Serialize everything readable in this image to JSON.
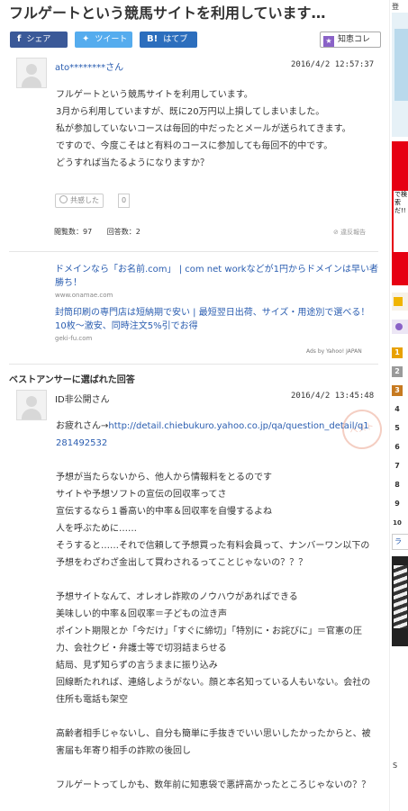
{
  "question": {
    "title": "フルゲートという競馬サイトを利用しています…",
    "share": {
      "facebook": "シェア",
      "twitter": "ツイート",
      "hatena": "はてブ"
    },
    "chie_kore": "知恵コレ",
    "username": "ato********さん",
    "date": "2016/4/2 12:57:37",
    "body": [
      "フルゲートという競馬サイトを利用しています。",
      "3月から利用していますが、既に20万円以上損してしまいました。",
      "私が参加していないコースは毎回的中だったとメールが送られてきます。",
      "ですので、今度こそはと有料のコースに参加しても毎回不的中です。",
      "どうすれば当たるようになりますか？"
    ],
    "empathy_label": "共感した",
    "empathy_count": "0",
    "views": "閲覧数：97",
    "answers": "回答数：2",
    "report": "違反報告"
  },
  "ads": [
    {
      "title": "ドメインなら「お名前.com」 | com net workなどが1円からドメインは早い者勝ち！",
      "domain": "www.onamae.com"
    },
    {
      "title": "封筒印刷の専門店は短納期で安い | 最短翌日出荷、サイズ・用途別で選べる！10枚〜激安、同時注文5%引でお得",
      "domain": "geki-fu.com"
    }
  ],
  "ads_by": "Ads by Yahoo! JAPAN",
  "best_answer": {
    "label": "ベストアンサーに選ばれた回答",
    "username": "ID非公開さん",
    "date": "2016/4/2 13:45:48",
    "intro": "お疲れさん→",
    "link": "http://detail.chiebukuro.yahoo.co.jp/qa/question_detail/q1281492532",
    "p1": [
      "予想が当たらないから、他人から情報料をとるのです",
      "サイトや予想ソフトの宣伝の回収率ってさ",
      "宣伝するなら１番高い的中率＆回収率を自慢するよね",
      "人を呼ぶために……",
      "そうすると……それで信頼して予想買った有料会員って、ナンバーワン以下の予想をわざわざ金出して買わされるってことじゃないの？？？"
    ],
    "p2": [
      "予想サイトなんて、オレオレ詐欺のノウハウがあればできる",
      "美味しい的中率＆回収率＝子どもの泣き声",
      "ポイント期限とか「今だけ」「すぐに締切」「特別に・お詫びに」＝官憲の圧力、会社クビ・弁護士等で切羽詰まらせる",
      "結局、見ず知らずの言うままに振り込み",
      "回線断たれれば、連絡しようがない。顔と本名知っている人もいない。会社の住所も電話も架空"
    ],
    "p3": [
      "高齢者相手じゃないし、自分も簡単に手抜きでいい思いしたかったからと、被害届も年寄り相手の詐欺の後回し"
    ],
    "p4": [
      "フルゲートってしかも、数年前に知恵袋で悪評高かったところじゃないの？？"
    ],
    "stamp": "ベスト"
  },
  "sidebar": {
    "top_text": "登",
    "ad_text": "で検索だ!!",
    "ranks": [
      "1",
      "2",
      "3",
      "4",
      "5",
      "6",
      "7",
      "8",
      "9",
      "10"
    ],
    "box_text": "ラ",
    "bottom_text": "S"
  },
  "colors": {
    "link": "#2a5db0",
    "facebook": "#3b5998",
    "twitter": "#55acee",
    "hatena": "#2c6ebd",
    "chie": "#8a62c7"
  }
}
